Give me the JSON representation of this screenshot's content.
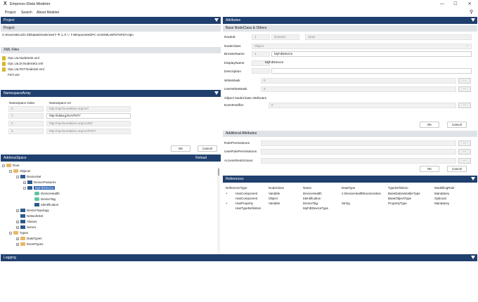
{
  "app": {
    "logo": "X",
    "title": "Empress iData Modeler"
  },
  "menu": [
    "Project",
    "Search",
    "About Modeler"
  ],
  "project": {
    "header": "Project",
    "section": "Project",
    "path": "C:¥Users¥Koichi Shibata¥OneDrive¥ドキュメント¥Empress¥OPC UA¥XMLs¥FDT¥FDT.eipn",
    "xml_section": "XML Files",
    "xml_files": [
      "Opc.Ua.NodeSet2.xml",
      "Opc.Ua.Di.NodeSet2.xml",
      "Opc.Ua.FDT.NodeSet.xml",
      "FDT.xml"
    ]
  },
  "ns": {
    "header": "NamespaceArray",
    "col_index": "Namespace Index",
    "col_uri": "Namespace Uri",
    "rows": [
      {
        "i": "0",
        "u": "http://opcfoundation.org/UA/"
      },
      {
        "i": "1",
        "u": "http://idata.jp/UA/FDT/"
      },
      {
        "i": "2",
        "u": "http://opcfoundation.org/UA/DI/"
      },
      {
        "i": "3",
        "u": "http://opcfoundation.org/UA/FDT/"
      }
    ],
    "ok": "OK",
    "cancel": "Cancel"
  },
  "addr": {
    "header": "AddressSpace",
    "reload": "Reload",
    "tree": [
      "Root",
      "Objects",
      "DeviceSet",
      "DeviceFeatures",
      "MyFdtDevice",
      "DeviceHealth",
      "DeviceTag",
      "Identification",
      "DeviceTopology",
      "NetworkSet",
      "Aliases",
      "Server",
      "Types",
      "DataTypes",
      "EventTypes"
    ]
  },
  "attr": {
    "header": "Attributes",
    "base_section": "Base NodeClass & Others",
    "nodeid_label": "NodeId",
    "nodeid_ns": "1",
    "nodeid_type": "Numeric",
    "nodeid_value": "1616",
    "nodeclass_label": "NodeClass",
    "nodeclass_value": "Object",
    "browse_label": "BrowseName",
    "browse_ns": "1",
    "browse_value": "MyFdtDevice",
    "display_label": "DisplayName",
    "display_value": "MyFdtDevice",
    "desc_label": "Description",
    "wm_label": "WriteMask",
    "wm_value": "0",
    "uwm_label": "UserWriteMask",
    "uwm_value": "0",
    "obj_section": "Object NodeClass Attributes",
    "en_label": "EventNotifier",
    "en_value": "0",
    "ok": "OK",
    "cancel": "Cancel",
    "add_section": "Additional Attributes",
    "rp_label": "RolePermissions",
    "urp_label": "UserRolePermissions",
    "ar_label": "AccessRestrictions",
    "dots": "..."
  },
  "refs": {
    "header": "References",
    "cols": [
      "ReferenceType",
      "NodeClass",
      "Name",
      "DataType",
      "TypeDefinition",
      "ModellingRule"
    ],
    "rows": [
      {
        "e": "+",
        "t": "HasComponent",
        "c": "Variable",
        "n": "DeviceHealth",
        "d": "2 DeviceHealthEnumeration",
        "td": "BaseDataVariableType",
        "m": "Mandatory"
      },
      {
        "e": "",
        "t": "HasComponent",
        "c": "Object",
        "n": "Identification",
        "d": "",
        "td": "BaseObjectType",
        "m": "Optional"
      },
      {
        "e": "+",
        "t": "HasProperty",
        "c": "Variable",
        "n": "DeviceTag",
        "d": "String",
        "td": "PropertyType",
        "m": "Mandatory"
      },
      {
        "e": "",
        "t": "HasTypeDefinition",
        "c": "",
        "n": "MyFdtDeviceType",
        "d": "",
        "td": "",
        "m": ""
      }
    ]
  },
  "logging": {
    "header": "Logging"
  }
}
